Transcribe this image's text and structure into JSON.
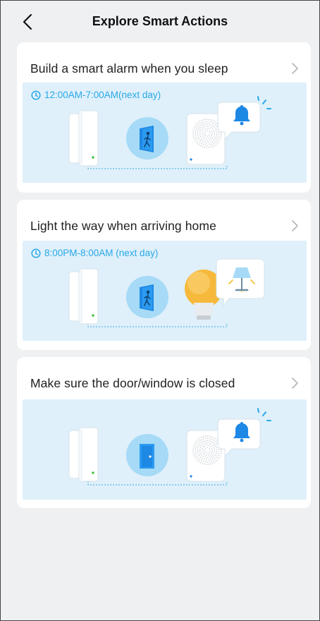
{
  "header": {
    "title": "Explore Smart Actions"
  },
  "cards": [
    {
      "title": "Build a smart alarm when you sleep",
      "time": "12:00AM-7:00AM(next day)"
    },
    {
      "title": "Light the way when arriving home",
      "time": "8:00PM-8:00AM (next day)"
    },
    {
      "title": "Make sure the door/window is closed"
    }
  ],
  "colors": {
    "accent": "#29a8e6",
    "banner": "#dff0fb",
    "door_bg": "#a6daf6",
    "door": "#1e88e5",
    "sensor_led": "#3fbf3f",
    "bulb": "#f6b93b"
  },
  "icons": [
    "back-icon",
    "chevron-right-icon",
    "clock-icon",
    "door-sensor-icon",
    "door-person-icon",
    "door-icon",
    "alarm-hub-icon",
    "bell-icon",
    "bulb-icon",
    "lamp-icon"
  ]
}
